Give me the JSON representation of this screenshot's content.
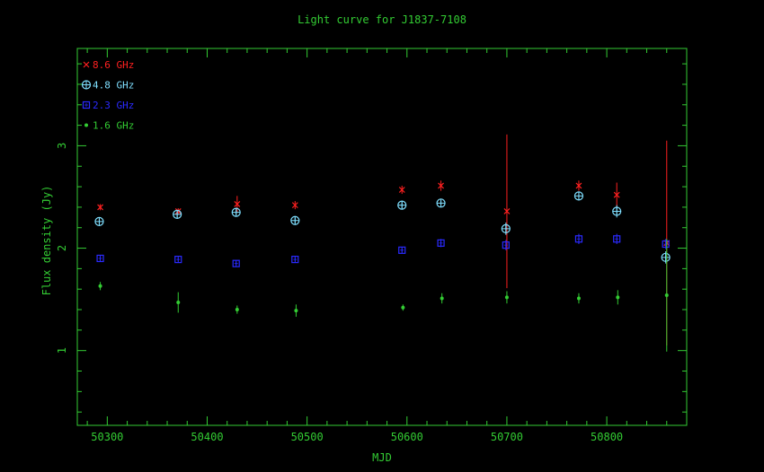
{
  "chart_data": {
    "type": "scatter",
    "title": "Light curve for J1837-7108",
    "xlabel": "MJD",
    "ylabel": "Flux density (Jy)",
    "xlim": [
      50270,
      50880
    ],
    "ylim": [
      0.27,
      3.95
    ],
    "x_ticks": [
      50300,
      50400,
      50500,
      50600,
      50700,
      50800
    ],
    "y_ticks": [
      1,
      2,
      3
    ],
    "legend_position": "top-left",
    "grid": false,
    "series": [
      {
        "name": "8.6 GHz",
        "color": "#ff2020",
        "marker": "x",
        "points": [
          {
            "x": 50293,
            "y": 2.4,
            "err": 0.03
          },
          {
            "x": 50371,
            "y": 2.36,
            "err": 0.03
          },
          {
            "x": 50430,
            "y": 2.43,
            "err": 0.08
          },
          {
            "x": 50488,
            "y": 2.42,
            "err": 0.04
          },
          {
            "x": 50595,
            "y": 2.57,
            "err": 0.04
          },
          {
            "x": 50634,
            "y": 2.61,
            "err": 0.05
          },
          {
            "x": 50700,
            "y": 2.36,
            "err": 0.75
          },
          {
            "x": 50772,
            "y": 2.61,
            "err": 0.05
          },
          {
            "x": 50810,
            "y": 2.52,
            "err": 0.12
          },
          {
            "x": 50860,
            "y": 2.05,
            "err": 1.0
          }
        ]
      },
      {
        "name": "4.8 GHz",
        "color": "#7fdfff",
        "marker": "circle-plus",
        "points": [
          {
            "x": 50292,
            "y": 2.26,
            "err": 0.03
          },
          {
            "x": 50370,
            "y": 2.33,
            "err": 0.03
          },
          {
            "x": 50429,
            "y": 2.35,
            "err": 0.03
          },
          {
            "x": 50488,
            "y": 2.27,
            "err": 0.03
          },
          {
            "x": 50595,
            "y": 2.42,
            "err": 0.03
          },
          {
            "x": 50634,
            "y": 2.44,
            "err": 0.03
          },
          {
            "x": 50699,
            "y": 2.19,
            "err": 0.06
          },
          {
            "x": 50772,
            "y": 2.51,
            "err": 0.04
          },
          {
            "x": 50810,
            "y": 2.36,
            "err": 0.06
          },
          {
            "x": 50859,
            "y": 1.91,
            "err": 0.06
          }
        ]
      },
      {
        "name": "2.3 GHz",
        "color": "#2a2aff",
        "marker": "square",
        "points": [
          {
            "x": 50293,
            "y": 1.9,
            "err": 0.03
          },
          {
            "x": 50371,
            "y": 1.89,
            "err": 0.03
          },
          {
            "x": 50429,
            "y": 1.85,
            "err": 0.03
          },
          {
            "x": 50488,
            "y": 1.89,
            "err": 0.03
          },
          {
            "x": 50595,
            "y": 1.98,
            "err": 0.03
          },
          {
            "x": 50634,
            "y": 2.05,
            "err": 0.04
          },
          {
            "x": 50699,
            "y": 2.03,
            "err": 0.05
          },
          {
            "x": 50772,
            "y": 2.09,
            "err": 0.05
          },
          {
            "x": 50810,
            "y": 2.09,
            "err": 0.05
          },
          {
            "x": 50859,
            "y": 2.04,
            "err": 0.05
          }
        ]
      },
      {
        "name": "1.6 GHz",
        "color": "#33cc33",
        "marker": "dot",
        "points": [
          {
            "x": 50293,
            "y": 1.63,
            "err": 0.04
          },
          {
            "x": 50371,
            "y": 1.47,
            "err": 0.1
          },
          {
            "x": 50430,
            "y": 1.4,
            "err": 0.04
          },
          {
            "x": 50489,
            "y": 1.39,
            "err": 0.06
          },
          {
            "x": 50596,
            "y": 1.42,
            "err": 0.03
          },
          {
            "x": 50635,
            "y": 1.51,
            "err": 0.05
          },
          {
            "x": 50700,
            "y": 1.52,
            "err": 0.06
          },
          {
            "x": 50772,
            "y": 1.51,
            "err": 0.05
          },
          {
            "x": 50811,
            "y": 1.52,
            "err": 0.07
          },
          {
            "x": 50860,
            "y": 1.54,
            "err": 0.55
          }
        ]
      }
    ]
  }
}
